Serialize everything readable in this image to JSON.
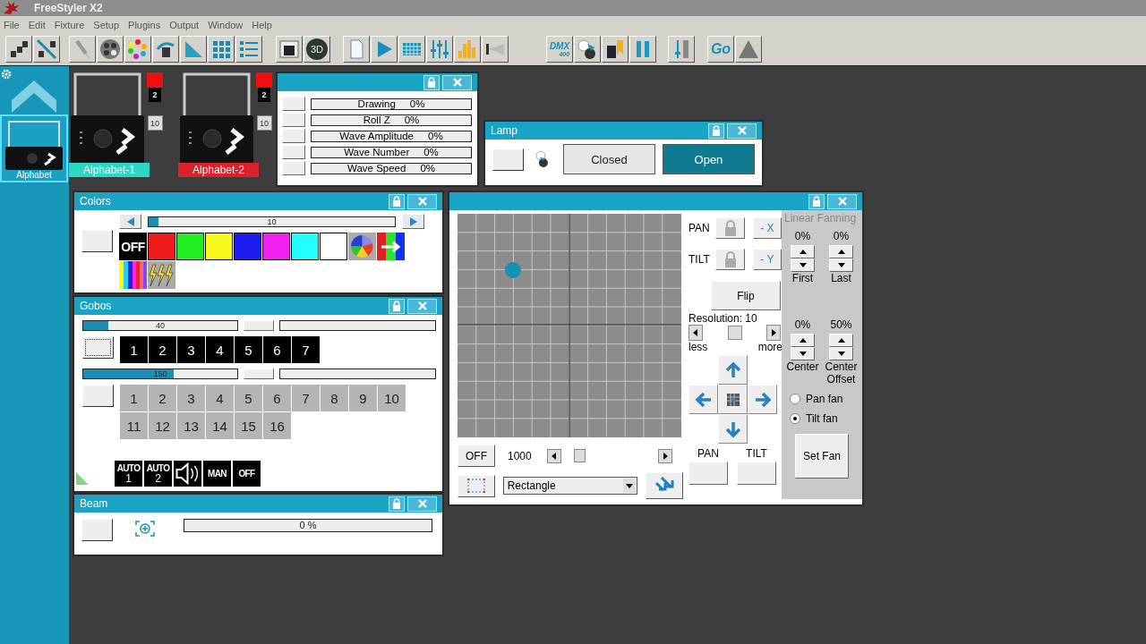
{
  "window": {
    "title": "FreeStyler X2"
  },
  "menu": [
    "File",
    "Edit",
    "Fixture",
    "Setup",
    "Plugins",
    "Output",
    "Window",
    "Help"
  ],
  "toolbar": [
    [
      {
        "kind": "fixtures"
      },
      {
        "kind": "unlink"
      }
    ],
    [
      {
        "kind": "lamp"
      },
      {
        "kind": "gobo"
      },
      {
        "kind": "palette"
      },
      {
        "kind": "move"
      },
      {
        "kind": "ramp"
      },
      {
        "kind": "grid"
      },
      {
        "kind": "list"
      }
    ],
    [
      {
        "kind": "window"
      },
      {
        "kind": "label",
        "label": "3D"
      }
    ],
    [
      {
        "kind": "page"
      },
      {
        "kind": "play"
      },
      {
        "kind": "matrix"
      },
      {
        "kind": "faders"
      },
      {
        "kind": "bars"
      },
      {
        "kind": "beam"
      }
    ],
    [
      {
        "kind": "dmx",
        "label": "DMX",
        "sub": "400"
      },
      {
        "kind": "cue"
      },
      {
        "kind": "tag"
      },
      {
        "kind": "pause"
      }
    ],
    [
      {
        "kind": "fader"
      }
    ],
    [
      {
        "kind": "go",
        "label": "Go"
      },
      {
        "kind": "warning"
      }
    ]
  ],
  "sidebar": {
    "group": "Alphabet",
    "selected": true
  },
  "fixtures": [
    {
      "name": "Alphabet-1",
      "color": "#2ed6c4",
      "channel": "2",
      "address": "10"
    },
    {
      "name": "Alphabet-2",
      "color": "#d9222a",
      "channel": "2",
      "address": "10"
    }
  ],
  "effects": [
    {
      "label": "Drawing",
      "value": "0%"
    },
    {
      "label": "Roll Z",
      "value": "0%"
    },
    {
      "label": "Wave Amplitude",
      "value": "0%"
    },
    {
      "label": "Wave Number",
      "value": "0%"
    },
    {
      "label": "Wave Speed",
      "value": "0%"
    }
  ],
  "lamp": {
    "title": "Lamp",
    "buttons": [
      {
        "label": "Closed",
        "selected": false
      },
      {
        "label": "Open",
        "selected": true
      }
    ]
  },
  "colors": {
    "title": "Colors",
    "slider": {
      "reading": "10",
      "level": 0.04
    },
    "swatches": [
      {
        "kind": "off",
        "label": "OFF"
      },
      {
        "kind": "color",
        "color": "#ee1c1c"
      },
      {
        "kind": "color",
        "color": "#22ee22"
      },
      {
        "kind": "color",
        "color": "#f8f81c"
      },
      {
        "kind": "color",
        "color": "#1c1cf0"
      },
      {
        "kind": "color",
        "color": "#f020f0"
      },
      {
        "kind": "color",
        "color": "#22ffff"
      },
      {
        "kind": "color",
        "color": "#ffffff"
      },
      {
        "kind": "wheel"
      },
      {
        "kind": "split"
      },
      {
        "kind": "rainbow"
      },
      {
        "kind": "strobe"
      }
    ]
  },
  "gobos": {
    "title": "Gobos",
    "wheel_1": {
      "reading": "40",
      "level": 0.16
    },
    "gobos_1": [
      "1",
      "2",
      "3",
      "4",
      "5",
      "6",
      "7"
    ],
    "wheel_2": {
      "reading": "150",
      "level": 0.59
    },
    "gobos_2": [
      "1",
      "2",
      "3",
      "4",
      "5",
      "6",
      "7",
      "8",
      "9",
      "10",
      "11",
      "12",
      "13",
      "14",
      "15",
      "16"
    ],
    "modes": [
      {
        "kind": "text",
        "label": "AUTO",
        "sub": "1"
      },
      {
        "kind": "text",
        "label": "AUTO",
        "sub": "2"
      },
      {
        "kind": "sound"
      },
      {
        "kind": "text",
        "label": "MAN"
      },
      {
        "kind": "text",
        "label": "OFF"
      }
    ]
  },
  "beam": {
    "title": "Beam",
    "reading": "0 %"
  },
  "movement": {
    "pan": "PAN",
    "tilt": "TILT",
    "invert_x": "- X",
    "invert_y": "- Y",
    "flip": "Flip",
    "resolution": "Resolution: 10",
    "resolution_level": {
      "level": 0.5
    },
    "less": "less",
    "more": "more",
    "off": "OFF",
    "speed": "1000",
    "shape": "Rectangle",
    "pan_field": "PAN",
    "tilt_field": "TILT"
  },
  "fanning": {
    "title": "Linear Fanning",
    "spinners": [
      {
        "value": "0%",
        "label": "First"
      },
      {
        "value": "0%",
        "label": "Last"
      },
      {
        "value": "0%",
        "label": "Center"
      },
      {
        "value": "50%",
        "label": "Center Offset"
      }
    ],
    "modes": [
      {
        "label": "Pan fan",
        "selected": false
      },
      {
        "label": "Tilt fan",
        "selected": true
      }
    ],
    "button": "Set Fan"
  }
}
